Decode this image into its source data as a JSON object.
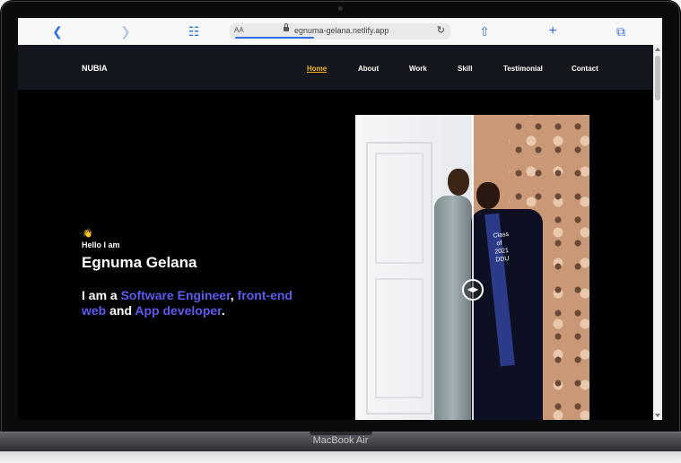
{
  "browser": {
    "url": "egnuma-gelana.netlify.app",
    "text_size_label": "AA",
    "icons": [
      "back-icon",
      "forward-icon",
      "bookmarks-icon",
      "lock-icon",
      "reload-icon",
      "share-icon",
      "new-tab-icon",
      "tabs-icon"
    ]
  },
  "nav": {
    "brand": "NUBIA",
    "links": [
      "Home",
      "About",
      "Work",
      "Skill",
      "Testimonial",
      "Contact"
    ],
    "active": "Home"
  },
  "hero": {
    "wave": "👋",
    "greeting": "Hello I am",
    "name": "Egnuma Gelana",
    "tagline": {
      "prefix": "I am a ",
      "role1": "Software Engineer",
      "sep1": ", ",
      "role2": "front-end web",
      "sep2": " and ",
      "role3": "App developer",
      "suffix": "."
    },
    "photo_text": "Class of 2021 DDU"
  },
  "device": {
    "label": "MacBook Air"
  },
  "colors": {
    "accent_nav": "#f0b51a",
    "highlight": "#5b5bf0",
    "nav_bg": "#13161c",
    "page_bg": "#000000"
  }
}
